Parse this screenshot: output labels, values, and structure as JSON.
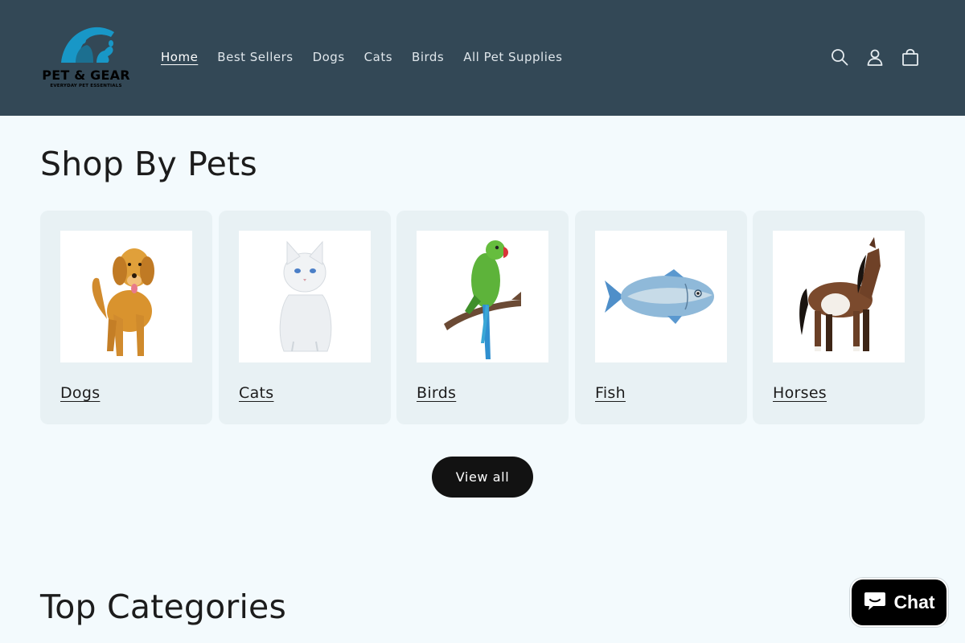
{
  "brand": {
    "name": "PET & GEAR",
    "tagline": "EVERYDAY PET ESSENTIALS",
    "icon": "pet-logo-icon",
    "color": "#1897c7"
  },
  "header": {
    "background": "#334856",
    "nav": [
      {
        "label": "Home",
        "active": true
      },
      {
        "label": "Best Sellers"
      },
      {
        "label": "Dogs"
      },
      {
        "label": "Cats"
      },
      {
        "label": "Birds"
      },
      {
        "label": "All Pet Supplies"
      }
    ],
    "icons": [
      "search-icon",
      "account-icon",
      "cart-icon"
    ]
  },
  "shop_by_pets": {
    "title": "Shop By Pets",
    "cards": [
      {
        "label": "Dogs",
        "image": "golden-retriever"
      },
      {
        "label": "Cats",
        "image": "white-cat"
      },
      {
        "label": "Birds",
        "image": "green-parrot"
      },
      {
        "label": "Fish",
        "image": "blue-fish"
      },
      {
        "label": "Horses",
        "image": "brown-white-horse"
      }
    ],
    "view_all_label": "View all"
  },
  "top_categories": {
    "title": "Top Categories"
  },
  "chat": {
    "label": "Chat",
    "icon": "chat-bubble-icon"
  }
}
